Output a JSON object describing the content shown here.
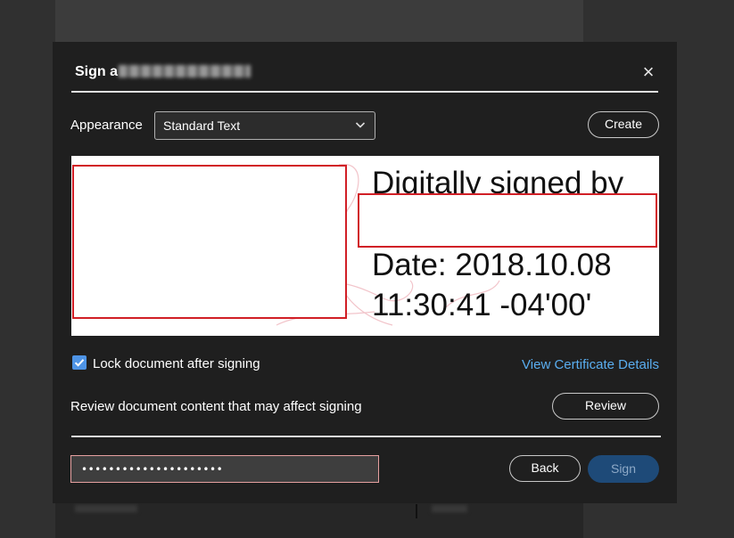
{
  "dialog": {
    "title": "Sign a",
    "close_glyph": "×"
  },
  "appearance": {
    "label": "Appearance",
    "selected": "Standard Text",
    "create_label": "Create"
  },
  "preview": {
    "line1": "Digitally signed by",
    "line3": "Date: 2018.10.08",
    "line4": "11:30:41 -04'00'"
  },
  "options": {
    "lock_label": "Lock document after signing",
    "lock_checked": true,
    "certificate_link": "View Certificate Details",
    "review_text": "Review document content that may affect signing",
    "review_label": "Review"
  },
  "footer": {
    "password_value": "•••••••••••••••••••••",
    "back_label": "Back",
    "sign_label": "Sign"
  },
  "icons": {
    "close": "close-icon",
    "dropdown": "chevron-down-icon",
    "checkbox": "checkmark-icon"
  },
  "colors": {
    "dialog_bg": "#1f1f1f",
    "accent_link": "#5aaef0",
    "checkbox": "#4e94e6",
    "sign_button": "#1e4a78",
    "redaction_border": "#d11f26"
  }
}
